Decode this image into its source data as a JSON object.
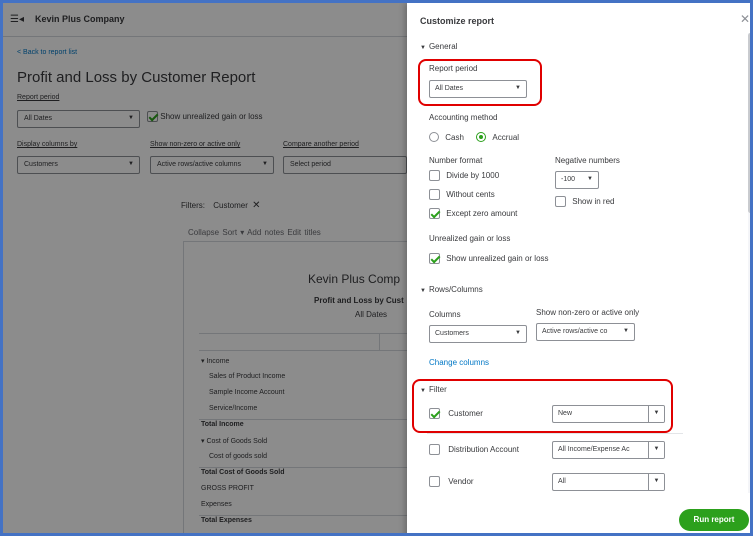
{
  "app": {
    "menu_icon": "hamburger-menu-icon",
    "company_name": "Kevin Plus Company"
  },
  "report_page": {
    "back_link": "< Back to report list",
    "title": "Profit and Loss by Customer Report",
    "report_period_label": "Report period",
    "report_period_value": "All Dates",
    "show_unrealized_label": "Show unrealized gain or loss",
    "display_columns_label": "Display columns by",
    "display_columns_value": "Customers",
    "non_zero_label": "Show non-zero or active only",
    "non_zero_value": "Active rows/active columns",
    "compare_label": "Compare another period",
    "compare_value": "Select period",
    "filters_label": "Filters:",
    "filter_chip": "Customer",
    "toolbar": [
      "Collapse",
      "Sort ▾",
      "Add notes",
      "Edit titles"
    ],
    "paper_company": "Kevin Plus Comp",
    "paper_report": "Profit and Loss by Cust",
    "paper_dates": "All Dates",
    "rows": [
      {
        "label": "▾ Income",
        "indent": 0,
        "total": false
      },
      {
        "label": "Sales of Product Income",
        "indent": 1,
        "total": false
      },
      {
        "label": "Sample Income Account",
        "indent": 1,
        "total": false
      },
      {
        "label": "Service/Income",
        "indent": 1,
        "total": false
      },
      {
        "label": "Total Income",
        "indent": 0,
        "total": true
      },
      {
        "label": "▾ Cost of Goods Sold",
        "indent": 0,
        "total": false
      },
      {
        "label": "Cost of goods sold",
        "indent": 1,
        "total": false
      },
      {
        "label": "Total Cost of Goods Sold",
        "indent": 0,
        "total": true
      },
      {
        "label": "GROSS PROFIT",
        "indent": 0,
        "total": false
      },
      {
        "label": "Expenses",
        "indent": 0,
        "total": false
      },
      {
        "label": "Total Expenses",
        "indent": 0,
        "total": true
      }
    ]
  },
  "panel": {
    "title": "Customize report",
    "close_icon": "close-icon",
    "general": "General",
    "report_period_label": "Report period",
    "report_period_value": "All Dates",
    "accounting_method_label": "Accounting method",
    "cash": "Cash",
    "accrual": "Accrual",
    "number_format_label": "Number format",
    "divide_by_1000": "Divide by 1000",
    "without_cents": "Without cents",
    "except_zero_amount": "Except zero amount",
    "negative_numbers_label": "Negative numbers",
    "negative_numbers_value": "-100",
    "show_in_red": "Show in red",
    "unrealized_label": "Unrealized gain or loss",
    "show_unrealized": "Show unrealized gain or loss",
    "rows_columns": "Rows/Columns",
    "columns_label": "Columns",
    "columns_value": "Customers",
    "non_zero_label": "Show non-zero or active only",
    "non_zero_value": "Active rows/active co",
    "change_columns": "Change columns",
    "filter": "Filter",
    "customer_label": "Customer",
    "customer_value": "New",
    "distribution_label": "Distribution Account",
    "distribution_value": "All Income/Expense Ac",
    "vendor_label": "Vendor",
    "vendor_value": "All",
    "run_report": "Run report"
  },
  "colors": {
    "accent_green": "#2ca01c",
    "link_blue": "#0077c5",
    "highlight_red": "#e00000",
    "frame_blue": "#4472c4"
  }
}
